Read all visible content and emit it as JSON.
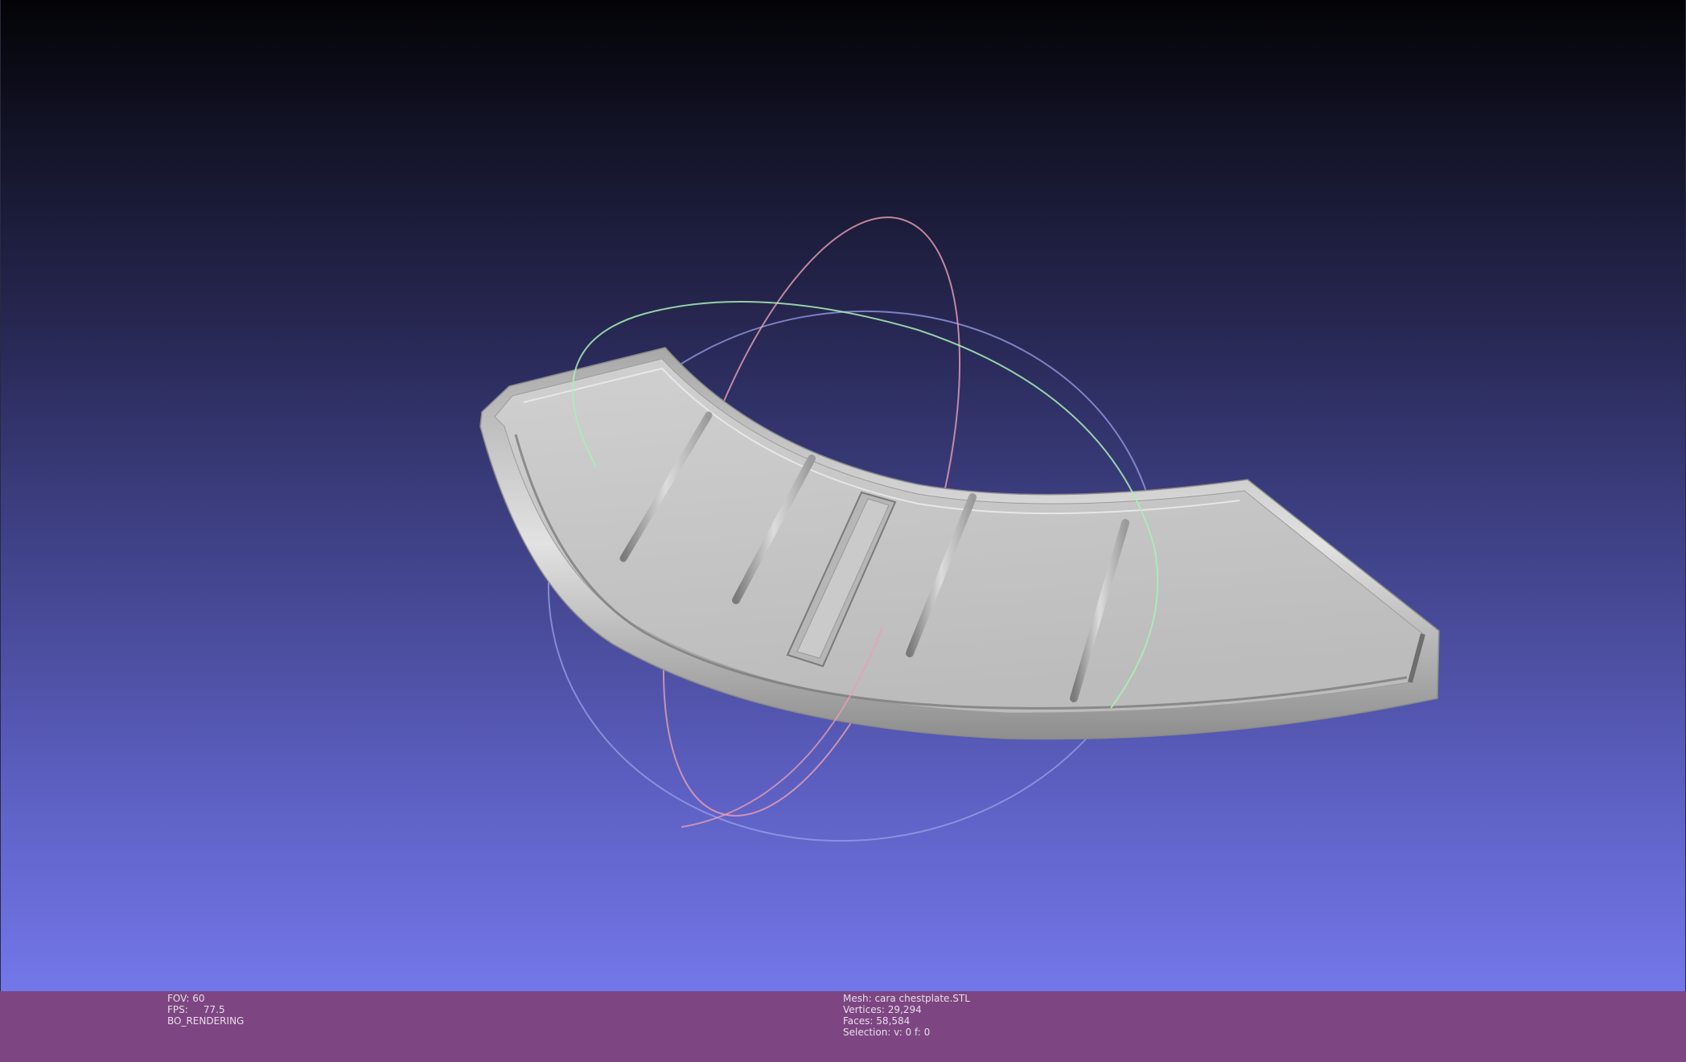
{
  "status": {
    "left": {
      "fov": "FOV: 60",
      "fps": "FPS:     77.5",
      "rendering_mode": "BO_RENDERING"
    },
    "mesh": {
      "name": "Mesh: cara chestplate.STL",
      "vertices": "Vertices: 29,294",
      "faces": "Faces: 58,584",
      "selection": "Selection: v: 0 f: 0"
    }
  },
  "colors": {
    "background_top": "#030306",
    "background_bottom": "#7377e9",
    "status_bar": "#7d4682",
    "mesh_surface": "#c2c2c2",
    "trackball_x": "#f0a0b0",
    "trackball_y": "#a0f0b0",
    "trackball_z": "#a0a8f0"
  }
}
